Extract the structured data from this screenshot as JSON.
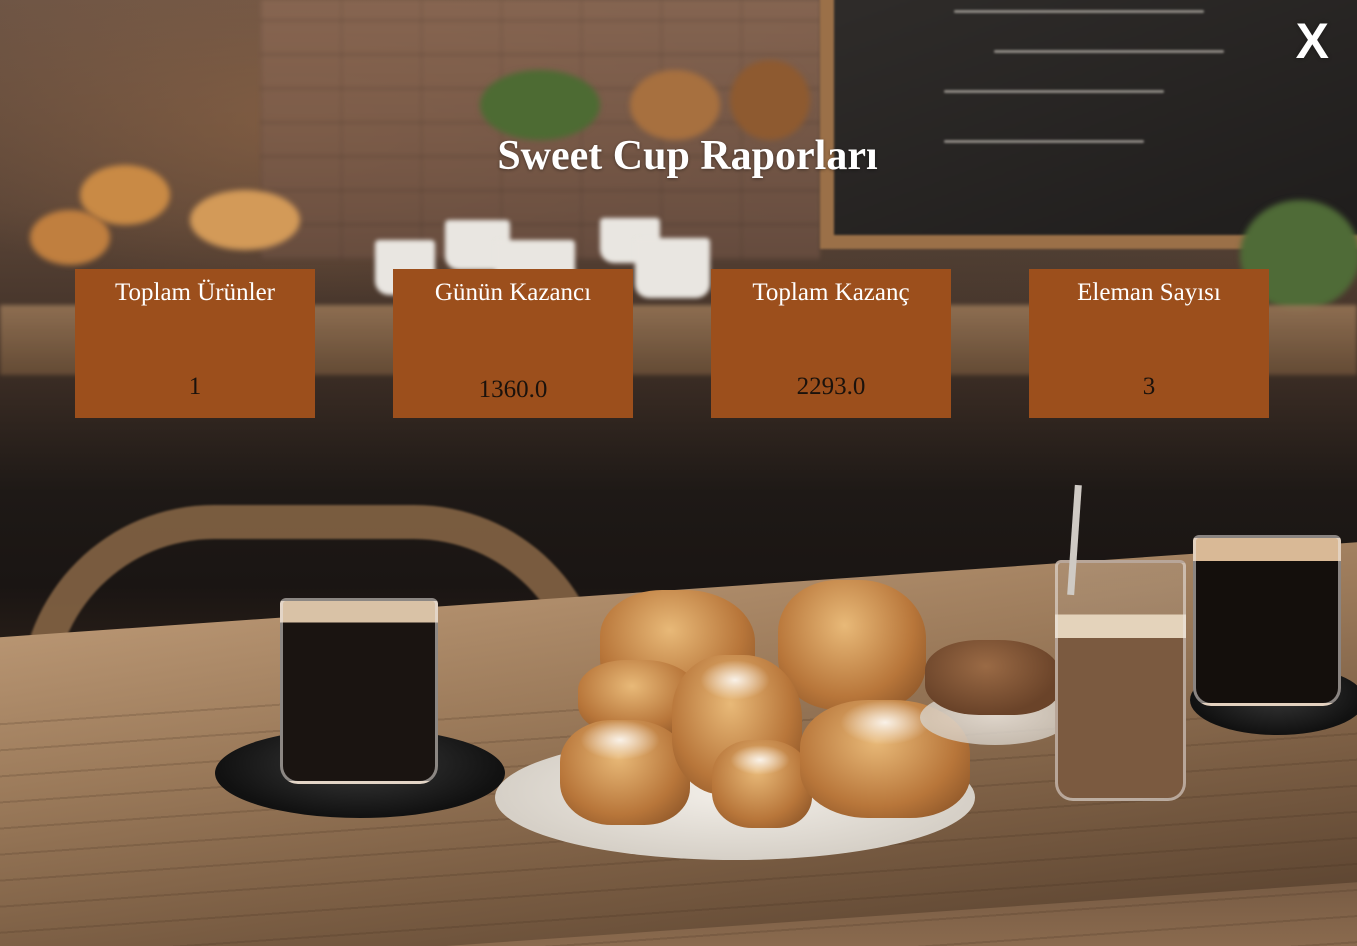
{
  "window": {
    "close_label": "X"
  },
  "header": {
    "title": "Sweet Cup Raporları"
  },
  "cards": [
    {
      "label": "Toplam Ürünler",
      "value": "1"
    },
    {
      "label": "Günün Kazancı",
      "value": "1360.0"
    },
    {
      "label": "Toplam Kazanç",
      "value": "2293.0"
    },
    {
      "label": "Eleman Sayısı",
      "value": "3"
    }
  ],
  "colors": {
    "card_background": "#9c4f1c",
    "title_text": "#ffffff",
    "value_text": "#1a120c"
  }
}
